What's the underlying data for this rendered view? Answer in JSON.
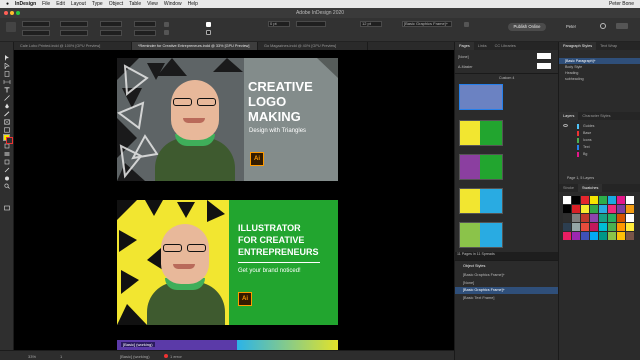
{
  "menubar": {
    "app": "InDesign",
    "items": [
      "File",
      "Edit",
      "Layout",
      "Type",
      "Object",
      "Table",
      "View",
      "Window",
      "Help"
    ],
    "user": "Peter Bone",
    "clock": ""
  },
  "window": {
    "title": "Adobe InDesign 2020"
  },
  "control": {
    "share_label": "Publish Online",
    "user_menu": "Peter",
    "stroke_weight": "0 pt",
    "object_style": "[Basic Graphics Frame]+",
    "zoom": "12 pt"
  },
  "tabs": [
    {
      "label": "Cale Lobo Printed.indd @ 100% [GPU Preview]"
    },
    {
      "label": "*Reminder for Creative Entrepreneurs.indd @ 33% [GPU Preview]"
    },
    {
      "label": "Go Magazines.indd @ 40% [GPU Preview]"
    }
  ],
  "cards": {
    "card1": {
      "title_line1": "CREATIVE",
      "title_line2": "LOGO",
      "title_line3": "MAKING",
      "subtitle": "Design with Triangles",
      "badge": "Ai"
    },
    "card2": {
      "title_line1": "ILLUSTRATOR",
      "title_line2": "FOR CREATIVE",
      "title_line3": "ENTREPRENEURS",
      "subtitle": "Get your brand noticed!",
      "badge": "Ai"
    },
    "card3": {
      "label": "[Basic] (working)"
    }
  },
  "statusbar": {
    "zoom": "33%",
    "page": "1",
    "mode": "[Basic] (working)",
    "errors": "1 error"
  },
  "pages_panel": {
    "tabs": [
      "Pages",
      "Links",
      "CC Libraries"
    ],
    "none_label": "[None]",
    "master_label": "A-Master",
    "custom_label": "Custom 4",
    "footer": "11 Pages in 11 Spreads"
  },
  "object_styles": {
    "title": "Object Styles",
    "selected": "[Basic Graphics Frame]+",
    "items": [
      "[None]",
      "[Basic Graphics Frame]+",
      "[Basic Text Frame]"
    ]
  },
  "paragraph_styles": {
    "tabs": [
      "Paragraph Styles",
      "Text Wrap"
    ],
    "items": [
      "[Basic Paragraph]+",
      "Body Style",
      "Heading",
      "subheading"
    ]
  },
  "layers": {
    "tabs": [
      "Layers",
      "Character Styles"
    ],
    "items": [
      "Guides",
      "Base",
      "Icons",
      "Text",
      "Bg"
    ],
    "footer": "Page 1, 5 Layers"
  },
  "swatches": {
    "tabs": [
      "Stroke",
      "Swatches"
    ],
    "colors": [
      "#ffffff",
      "#000000",
      "#e5262d",
      "#f6e500",
      "#2dae4a",
      "#1aa9e1",
      "#e2178a",
      "#ffffff",
      "#000000",
      "#d91f26",
      "#f7ed2f",
      "#32a849",
      "#29abe2",
      "#ee2a7b",
      "#7b3fa0",
      "#f39c12",
      "#2e2e2e",
      "#7f7f7f",
      "#c0392b",
      "#8e44ad",
      "#16a085",
      "#27ae60",
      "#d35400",
      "#ffffff",
      "#2c3e50",
      "#95a5a6",
      "#e74c3c",
      "#c2185b",
      "#00bcd4",
      "#4caf50",
      "#ff9800",
      "#ffeb3b",
      "#e91e63",
      "#9c27b0",
      "#3f51b5",
      "#03a9f4",
      "#009688",
      "#8bc34a",
      "#ffc107",
      "#795548"
    ]
  },
  "colors": {
    "accent": "#2680eb",
    "brand_green": "#22a52f",
    "brand_yellow": "#f2e630",
    "ai_orange": "#ff9a00"
  }
}
